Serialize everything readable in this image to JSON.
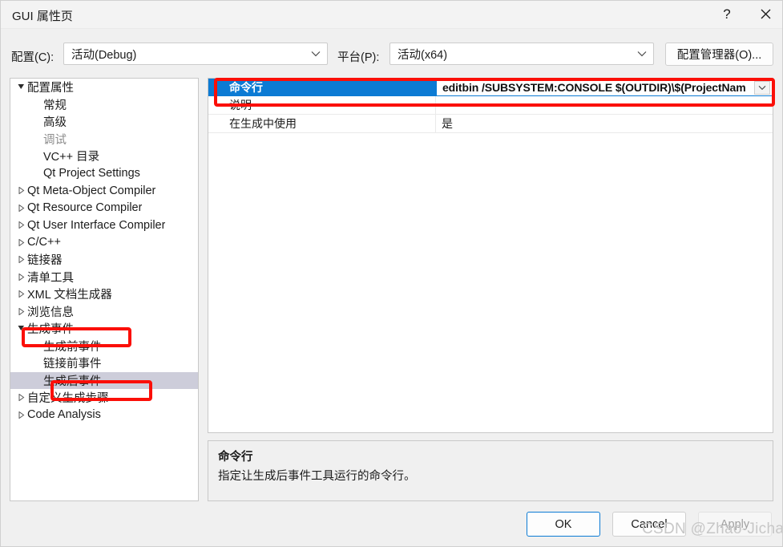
{
  "window": {
    "title": "GUI 属性页",
    "help_icon": "question-mark-icon",
    "close_icon": "close-x-icon"
  },
  "config_bar": {
    "config_label": "配置(C):",
    "config_value": "活动(Debug)",
    "platform_label": "平台(P):",
    "platform_value": "活动(x64)",
    "config_manager_label": "配置管理器(O)..."
  },
  "tree": {
    "items": [
      {
        "label": "配置属性",
        "level": 0,
        "twisty": "expanded",
        "selected": false,
        "dim": false
      },
      {
        "label": "常规",
        "level": 1,
        "twisty": "none",
        "selected": false,
        "dim": false
      },
      {
        "label": "高级",
        "level": 1,
        "twisty": "none",
        "selected": false,
        "dim": false
      },
      {
        "label": "调试",
        "level": 1,
        "twisty": "none",
        "selected": false,
        "dim": true
      },
      {
        "label": "VC++ 目录",
        "level": 1,
        "twisty": "none",
        "selected": false,
        "dim": false
      },
      {
        "label": "Qt Project Settings",
        "level": 1,
        "twisty": "none",
        "selected": false,
        "dim": false
      },
      {
        "label": "Qt Meta-Object Compiler",
        "level": 0,
        "twisty": "collapsed",
        "selected": false,
        "dim": false
      },
      {
        "label": "Qt Resource Compiler",
        "level": 0,
        "twisty": "collapsed",
        "selected": false,
        "dim": false
      },
      {
        "label": "Qt User Interface Compiler",
        "level": 0,
        "twisty": "collapsed",
        "selected": false,
        "dim": false
      },
      {
        "label": "C/C++",
        "level": 0,
        "twisty": "collapsed",
        "selected": false,
        "dim": false
      },
      {
        "label": "链接器",
        "level": 0,
        "twisty": "collapsed",
        "selected": false,
        "dim": false
      },
      {
        "label": "清单工具",
        "level": 0,
        "twisty": "collapsed",
        "selected": false,
        "dim": false
      },
      {
        "label": "XML 文档生成器",
        "level": 0,
        "twisty": "collapsed",
        "selected": false,
        "dim": false
      },
      {
        "label": "浏览信息",
        "level": 0,
        "twisty": "collapsed",
        "selected": false,
        "dim": false
      },
      {
        "label": "生成事件",
        "level": 0,
        "twisty": "expanded",
        "selected": false,
        "dim": false
      },
      {
        "label": "生成前事件",
        "level": 1,
        "twisty": "none",
        "selected": false,
        "dim": false
      },
      {
        "label": "链接前事件",
        "level": 1,
        "twisty": "none",
        "selected": false,
        "dim": false
      },
      {
        "label": "生成后事件",
        "level": 1,
        "twisty": "none",
        "selected": true,
        "dim": false
      },
      {
        "label": "自定义生成步骤",
        "level": 0,
        "twisty": "collapsed",
        "selected": false,
        "dim": false
      },
      {
        "label": "Code Analysis",
        "level": 0,
        "twisty": "collapsed",
        "selected": false,
        "dim": false
      }
    ]
  },
  "grid": {
    "rows": [
      {
        "name": "命令行",
        "value": "editbin /SUBSYSTEM:CONSOLE $(OUTDIR)\\$(ProjectNam",
        "selected": true,
        "has_dropdown": true
      },
      {
        "name": "说明",
        "value": "",
        "selected": false,
        "has_dropdown": false
      },
      {
        "name": "在生成中使用",
        "value": "是",
        "selected": false,
        "has_dropdown": false
      }
    ]
  },
  "description": {
    "title": "命令行",
    "body": "指定让生成后事件工具运行的命令行。"
  },
  "buttons": {
    "ok": "OK",
    "cancel": "Cancel",
    "apply": "Apply"
  },
  "watermark": "CSDN @Zhao-Jichao",
  "colors": {
    "accent": "#0c7bd4",
    "annotation": "#fb0f08",
    "tree_selection": "#cdcdda",
    "dialog_bg": "#f0f0f0"
  }
}
